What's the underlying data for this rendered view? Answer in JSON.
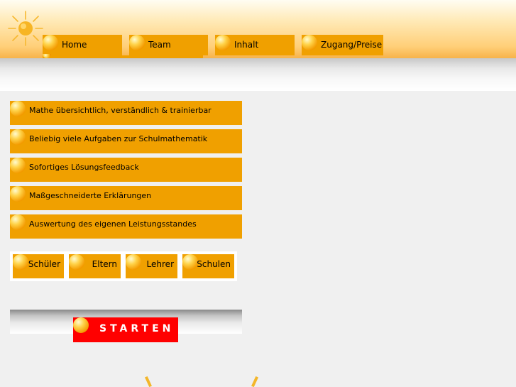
{
  "nav": {
    "items": [
      {
        "label": "Home"
      },
      {
        "label": "Team"
      },
      {
        "label": "Inhalt"
      },
      {
        "label": "Zugang/Preise"
      }
    ]
  },
  "features": {
    "items": [
      {
        "label": "Mathe übersichtlich, verständlich & trainierbar"
      },
      {
        "label": "Beliebig viele Aufgaben zur Schulmathematik"
      },
      {
        "label": "Sofortiges Lösungsfeedback"
      },
      {
        "label": "Maßgeschneiderte Erklärungen"
      },
      {
        "label": "Auswertung des eigenen Leistungsstandes"
      }
    ]
  },
  "audience": {
    "items": [
      {
        "label": "Schüler"
      },
      {
        "label": "Eltern"
      },
      {
        "label": "Lehrer"
      },
      {
        "label": "Schulen"
      }
    ]
  },
  "start": {
    "label": "STARTEN"
  },
  "colors": {
    "accent": "#f0a000",
    "start_button": "#ff0000",
    "background": "#f0f0f0"
  },
  "icons": {
    "logo": "sun-icon",
    "bullet": "orange-orb-icon"
  }
}
